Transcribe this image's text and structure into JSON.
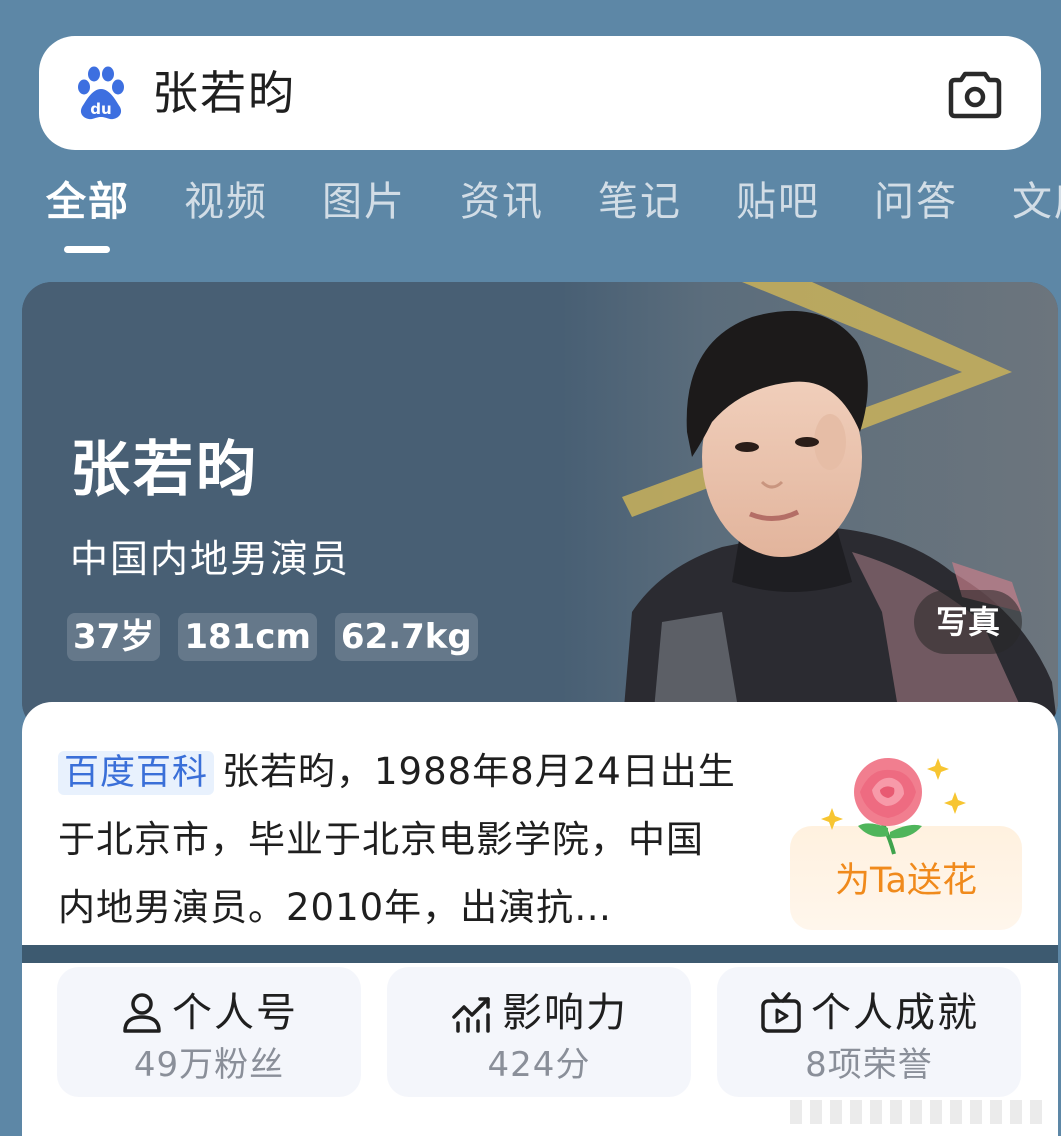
{
  "search": {
    "query": "张若昀"
  },
  "tabs": [
    {
      "label": "全部",
      "active": true
    },
    {
      "label": "视频",
      "active": false
    },
    {
      "label": "图片",
      "active": false
    },
    {
      "label": "资讯",
      "active": false
    },
    {
      "label": "笔记",
      "active": false
    },
    {
      "label": "贴吧",
      "active": false
    },
    {
      "label": "问答",
      "active": false
    },
    {
      "label": "文库",
      "active": false
    }
  ],
  "hero": {
    "name": "张若昀",
    "subtitle": "中国内地男演员",
    "tags": [
      "37岁",
      "181cm",
      "62.7kg"
    ],
    "photo_badge": "写真"
  },
  "info": {
    "source_tag": "百度百科",
    "bio": "张若昀，1988年8月24日出生于北京市，毕业于北京电影学院，中国内地男演员。2010年，出演抗…",
    "flower_button": "为Ta送花"
  },
  "stats": [
    {
      "title": "个人号",
      "value": "49万粉丝",
      "icon": "person-icon"
    },
    {
      "title": "影响力",
      "value": "424分",
      "icon": "trend-chart-icon"
    },
    {
      "title": "个人成就",
      "value": "8项荣誉",
      "icon": "tv-play-icon"
    }
  ],
  "colors": {
    "background": "#5d87a6",
    "hero_bg": "#485f74",
    "accent_blue": "#3a6fd8",
    "flower_orange": "#f08a1c"
  }
}
